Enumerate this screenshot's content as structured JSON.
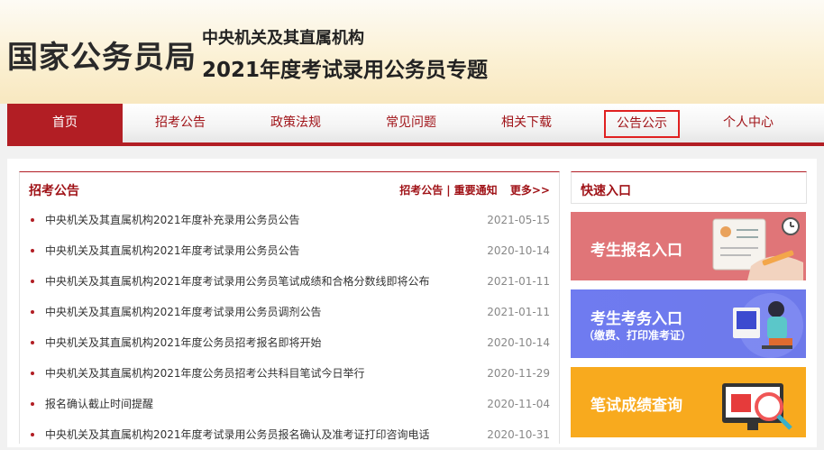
{
  "header": {
    "logo": "国家公务员局",
    "subtitle1": "中央机关及其直属机构",
    "subtitle2": "2021年度考试录用公务员专题"
  },
  "nav": {
    "items": [
      {
        "label": "首页"
      },
      {
        "label": "招考公告"
      },
      {
        "label": "政策法规"
      },
      {
        "label": "常见问题"
      },
      {
        "label": "相关下载"
      },
      {
        "label": "公告公示"
      },
      {
        "label": "个人中心"
      }
    ],
    "active_index": 0,
    "highlighted_index": 5
  },
  "news": {
    "title": "招考公告",
    "link1": "招考公告",
    "separator": "|",
    "link2": "重要通知",
    "more": "更多>>",
    "items": [
      {
        "title": "中央机关及其直属机构2021年度补充录用公务员公告",
        "date": "2021-05-15"
      },
      {
        "title": "中央机关及其直属机构2021年度考试录用公务员公告",
        "date": "2020-10-14"
      },
      {
        "title": "中央机关及其直属机构2021年度考试录用公务员笔试成绩和合格分数线即将公布",
        "date": "2021-01-11"
      },
      {
        "title": "中央机关及其直属机构2021年度考试录用公务员调剂公告",
        "date": "2021-01-11"
      },
      {
        "title": "中央机关及其直属机构2021年度公务员招考报名即将开始",
        "date": "2020-10-14"
      },
      {
        "title": "中央机关及其直属机构2021年度公务员招考公共科目笔试今日举行",
        "date": "2020-11-29"
      },
      {
        "title": "报名确认截止时间提醒",
        "date": "2020-11-04"
      },
      {
        "title": "中央机关及其直属机构2021年度考试录用公务员报名确认及准考证打印咨询电话",
        "date": "2020-10-31"
      }
    ]
  },
  "quick": {
    "title": "快速入口",
    "banner1": "考生报名入口",
    "banner2_line1": "考生考务入口",
    "banner2_line2": "（缴费、打印准考证）",
    "banner3": "笔试成绩查询"
  },
  "colors": {
    "brand_red": "#b21e24",
    "banner1": "#e07578",
    "banner2": "#6f7bf0",
    "banner3": "#f8aa1e"
  }
}
